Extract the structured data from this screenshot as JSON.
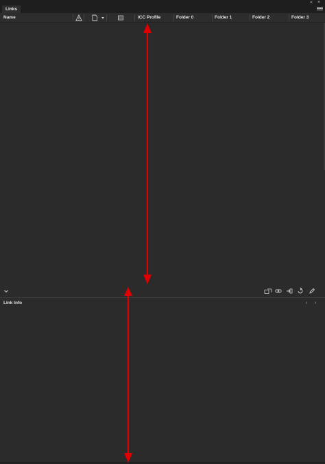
{
  "window": {
    "collapse_icon": "collapse-icon",
    "close_icon": "close-icon"
  },
  "panel": {
    "tab_label": "Links",
    "menu_icon": "panel-menu-icon"
  },
  "columns": {
    "name": "Name",
    "status_icon": "warning-icon",
    "page_icon": "page-icon",
    "layer_icon": "layers-icon",
    "icc_profile": "ICC Profile",
    "folder_0": "Folder 0",
    "folder_1": "Folder 1",
    "folder_2": "Folder 2",
    "folder_3": "Folder 3"
  },
  "toolbar": {
    "show_info_icon": "chevron-down-icon",
    "relink_from_cc_icon": "cc-relink-icon",
    "relink_icon": "link-icon",
    "goto_link_icon": "goto-link-icon",
    "update_link_icon": "update-link-icon",
    "edit_original_icon": "pencil-icon"
  },
  "link_info": {
    "title": "Link Info",
    "prev_icon": "chevron-left-icon",
    "next_icon": "chevron-right-icon"
  },
  "colors": {
    "panel_bg": "#2b2b2b",
    "header_bg": "#2d2d2d",
    "annotation": "#e00000"
  }
}
